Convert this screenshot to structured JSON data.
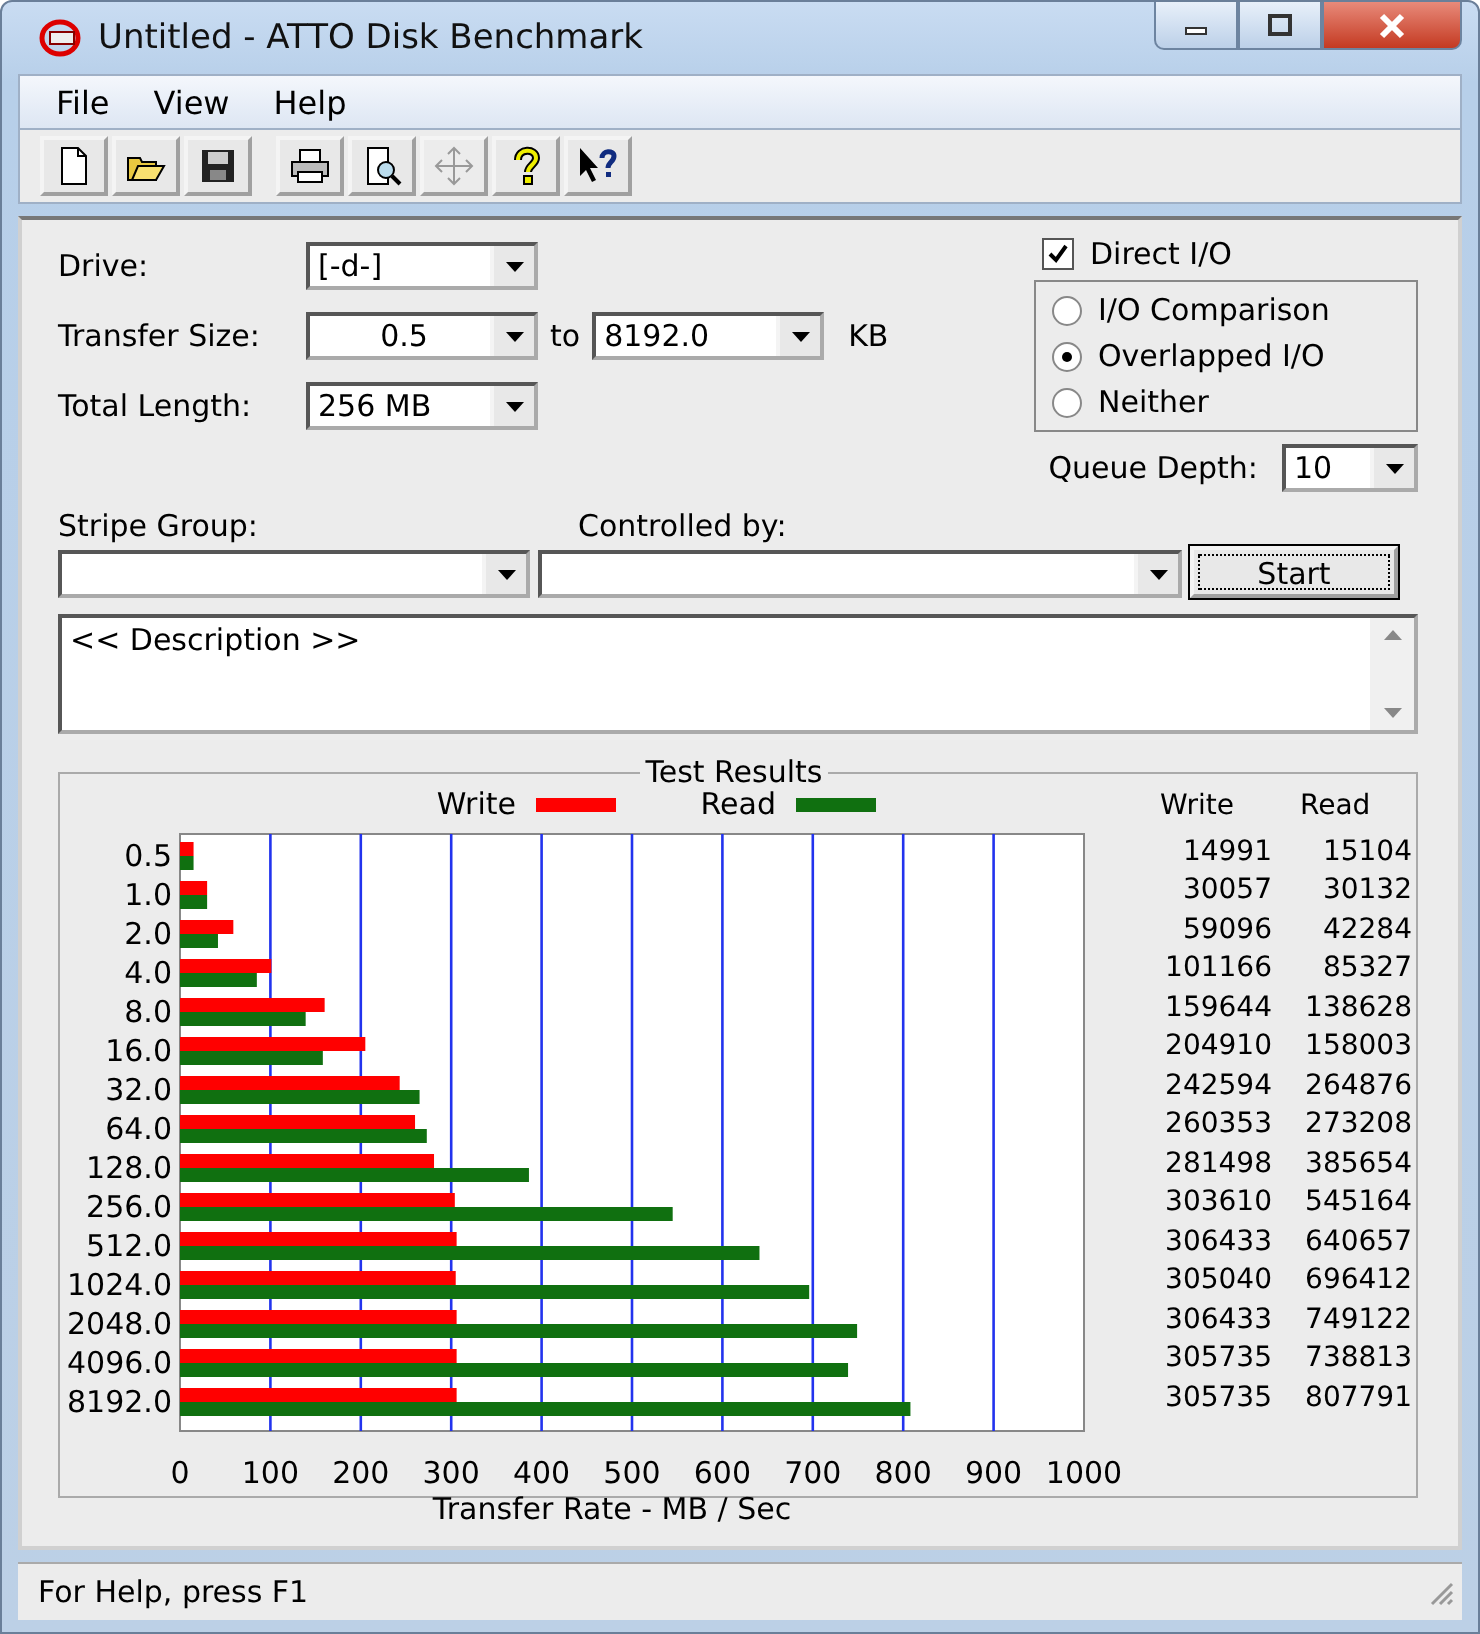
{
  "window": {
    "title": "Untitled - ATTO Disk Benchmark"
  },
  "menu": [
    "File",
    "View",
    "Help"
  ],
  "toolbar": [
    {
      "kind": "new",
      "disabled": false
    },
    {
      "kind": "open",
      "disabled": false
    },
    {
      "kind": "save",
      "disabled": false
    },
    {
      "kind": "print",
      "disabled": false
    },
    {
      "kind": "preview",
      "disabled": false
    },
    {
      "kind": "move",
      "disabled": true
    },
    {
      "kind": "help",
      "disabled": false
    },
    {
      "kind": "context-help",
      "disabled": false
    }
  ],
  "settings": {
    "drive": {
      "label": "Drive:",
      "value": "[-d-]"
    },
    "transfer_size": {
      "label": "Transfer Size:",
      "from": "0.5",
      "to_label": "to",
      "to": "8192.0",
      "unit": "KB"
    },
    "total_length": {
      "label": "Total Length:",
      "value": "256 MB"
    },
    "direct_io": {
      "label": "Direct I/O",
      "checked": true
    },
    "io_modes": [
      {
        "label": "I/O Comparison",
        "selected": false
      },
      {
        "label": "Overlapped I/O",
        "selected": true
      },
      {
        "label": "Neither",
        "selected": false
      }
    ],
    "queue_depth": {
      "label": "Queue Depth:",
      "value": "10"
    },
    "stripe_group": {
      "label": "Stripe Group:"
    },
    "controlled_by": {
      "label": "Controlled by:"
    },
    "start_button": "Start",
    "description": "<< Description >>"
  },
  "results": {
    "title": "Test Results",
    "column_headers": [
      "Write",
      "Read"
    ],
    "rows": [
      {
        "write": "14991",
        "read": "15104"
      },
      {
        "write": "30057",
        "read": "30132"
      },
      {
        "write": "59096",
        "read": "42284"
      },
      {
        "write": "101166",
        "read": "85327"
      },
      {
        "write": "159644",
        "read": "138628"
      },
      {
        "write": "204910",
        "read": "158003"
      },
      {
        "write": "242594",
        "read": "264876"
      },
      {
        "write": "260353",
        "read": "273208"
      },
      {
        "write": "281498",
        "read": "385654"
      },
      {
        "write": "303610",
        "read": "545164"
      },
      {
        "write": "306433",
        "read": "640657"
      },
      {
        "write": "305040",
        "read": "696412"
      },
      {
        "write": "306433",
        "read": "749122"
      },
      {
        "write": "305735",
        "read": "738813"
      },
      {
        "write": "305735",
        "read": "807791"
      }
    ],
    "chart_data": {
      "type": "bar",
      "orientation": "horizontal",
      "xlabel": "Transfer Rate - MB / Sec",
      "categories": [
        "0.5",
        "1.0",
        "2.0",
        "4.0",
        "8.0",
        "16.0",
        "32.0",
        "64.0",
        "128.0",
        "256.0",
        "512.0",
        "1024.0",
        "2048.0",
        "4096.0",
        "8192.0"
      ],
      "series": [
        {
          "name": "Write",
          "color": "#ff0000",
          "values": [
            15,
            30,
            59,
            101,
            160,
            205,
            243,
            260,
            281,
            304,
            306,
            305,
            306,
            306,
            306
          ]
        },
        {
          "name": "Read",
          "color": "#107010",
          "values": [
            15,
            30,
            42,
            85,
            139,
            158,
            265,
            273,
            386,
            545,
            641,
            696,
            749,
            739,
            808
          ]
        }
      ],
      "xlim": [
        0,
        1000
      ],
      "xticks": [
        0,
        100,
        200,
        300,
        400,
        500,
        600,
        700,
        800,
        900,
        1000
      ],
      "grid": true,
      "legend": true
    }
  },
  "status_bar": "For Help, press F1"
}
